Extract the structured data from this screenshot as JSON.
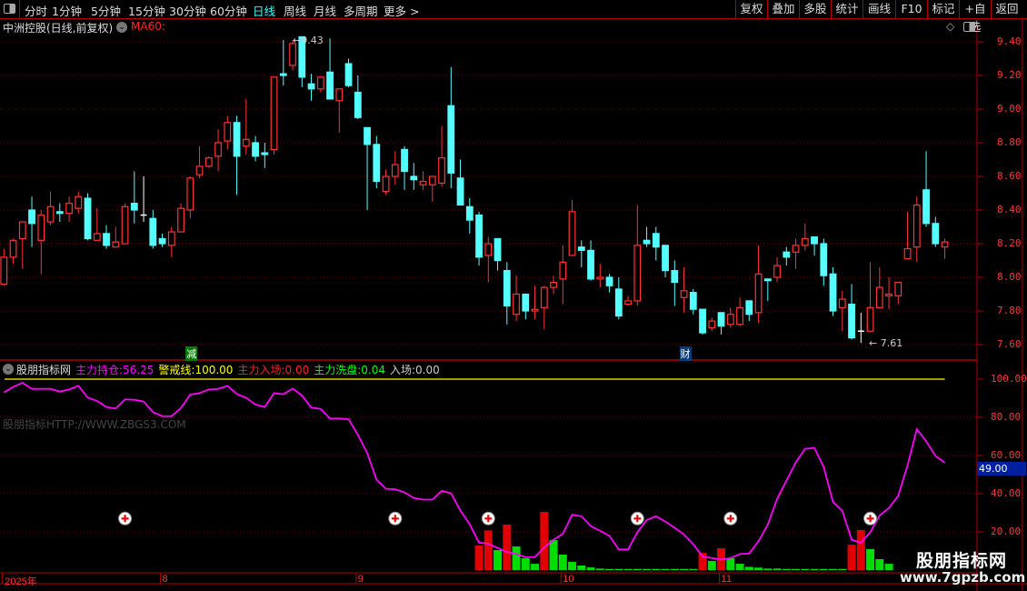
{
  "nav": {
    "periods": [
      "分时",
      "1分钟",
      "5分钟",
      "15分钟",
      "30分钟",
      "60分钟",
      "日线",
      "周线",
      "月线",
      "多周期",
      "更多 >"
    ],
    "active": "日线",
    "buttons": [
      "复权",
      "叠加",
      "多股",
      "统计",
      "画线",
      "F10",
      "标记",
      "+自选",
      "返回"
    ]
  },
  "main": {
    "title": "中洲控股(日线,前复权)",
    "ma_label": "MA60:",
    "high_marker": "9.43",
    "low_marker": "7.61",
    "event_tags": [
      {
        "text": "减",
        "candle": 21,
        "color": "#0a7a0a"
      },
      {
        "text": "财",
        "candle": 74,
        "color": "#0a3a7a"
      }
    ],
    "price_axis": [
      "9.40",
      "9.20",
      "9.00",
      "8.80",
      "8.60",
      "8.40",
      "8.20",
      "8.00",
      "7.80",
      "7.60"
    ]
  },
  "indicator": {
    "name": "股朋指标网",
    "items": [
      {
        "label": "主力持仓:",
        "value": "56.25",
        "color": "#ff00ff"
      },
      {
        "label": "警戒线:",
        "value": "100.00",
        "color": "#ffff00"
      },
      {
        "label": "主力入场:",
        "value": "0.00",
        "color": "#ff2020"
      },
      {
        "label": "主力洗盘:",
        "value": "0.04",
        "color": "#00ff00"
      },
      {
        "label": "入场:",
        "value": "0.00",
        "color": "#cccccc"
      }
    ],
    "watermark_url": "股朋指标HTTP://WWW.ZBGS3.COM",
    "axis": [
      "100.00",
      "80.00",
      "60.00",
      "40.00",
      "20.00"
    ],
    "current_box": "49.00"
  },
  "dates": [
    {
      "text": "2025年",
      "candle": 1
    },
    {
      "text": "8",
      "candle": 18
    },
    {
      "text": "9",
      "candle": 39
    },
    {
      "text": "10",
      "candle": 61
    },
    {
      "text": "11",
      "candle": 78
    }
  ],
  "brand": {
    "name": "股朋指标网",
    "url": "www.7gpzb.com"
  },
  "colors": {
    "up": "#ff3333",
    "down": "#55ffff",
    "doji": "#ffffff",
    "line": "#ff00ff",
    "warn": "#ffff00",
    "grid": "#800000",
    "border": "#b00000"
  },
  "chart_data": [
    {
      "type": "candlestick",
      "ylim": [
        7.55,
        9.45
      ],
      "grid": true,
      "candles_ochl": [
        [
          7.96,
          8.12,
          8.17,
          7.95
        ],
        [
          8.12,
          8.22,
          8.23,
          8.08
        ],
        [
          8.23,
          8.33,
          8.33,
          8.05
        ],
        [
          8.4,
          8.32,
          8.48,
          8.18
        ],
        [
          8.22,
          8.37,
          8.4,
          8.02
        ],
        [
          8.33,
          8.42,
          8.51,
          8.31
        ],
        [
          8.39,
          8.38,
          8.44,
          8.33
        ],
        [
          8.38,
          8.44,
          8.48,
          8.33
        ],
        [
          8.41,
          8.48,
          8.51,
          8.38
        ],
        [
          8.47,
          8.23,
          8.5,
          8.22
        ],
        [
          8.22,
          8.26,
          8.41,
          8.22
        ],
        [
          8.26,
          8.19,
          8.31,
          8.17
        ],
        [
          8.18,
          8.21,
          8.3,
          8.18
        ],
        [
          8.2,
          8.42,
          8.44,
          8.2
        ],
        [
          8.44,
          8.4,
          8.63,
          8.32
        ],
        [
          8.37,
          8.37,
          8.6,
          8.33
        ],
        [
          8.35,
          8.19,
          8.4,
          8.17
        ],
        [
          8.23,
          8.2,
          8.26,
          8.18
        ],
        [
          8.19,
          8.27,
          8.3,
          8.12
        ],
        [
          8.27,
          8.41,
          8.44,
          8.27
        ],
        [
          8.4,
          8.59,
          8.6,
          8.35
        ],
        [
          8.61,
          8.66,
          8.78,
          8.59
        ],
        [
          8.66,
          8.71,
          8.72,
          8.65
        ],
        [
          8.72,
          8.8,
          8.88,
          8.63
        ],
        [
          8.81,
          8.92,
          8.96,
          8.76
        ],
        [
          8.92,
          8.72,
          8.96,
          8.49
        ],
        [
          8.78,
          8.82,
          9.06,
          8.73
        ],
        [
          8.8,
          8.72,
          8.84,
          8.69
        ],
        [
          8.74,
          8.73,
          8.8,
          8.65
        ],
        [
          8.76,
          9.19,
          9.19,
          8.73
        ],
        [
          9.21,
          9.2,
          9.41,
          9.14
        ],
        [
          9.26,
          9.39,
          9.41,
          9.23
        ],
        [
          9.43,
          9.19,
          9.43,
          9.13
        ],
        [
          9.15,
          9.12,
          9.21,
          9.05
        ],
        [
          9.12,
          9.19,
          9.19,
          9.1
        ],
        [
          9.22,
          9.06,
          9.42,
          9.06
        ],
        [
          9.05,
          9.12,
          9.12,
          8.86
        ],
        [
          9.27,
          9.14,
          9.3,
          9.13
        ],
        [
          9.1,
          8.95,
          9.2,
          8.94
        ],
        [
          8.89,
          8.79,
          8.89,
          8.4
        ],
        [
          8.79,
          8.57,
          8.84,
          8.53
        ],
        [
          8.51,
          8.6,
          8.64,
          8.49
        ],
        [
          8.6,
          8.67,
          8.75,
          8.55
        ],
        [
          8.76,
          8.63,
          8.78,
          8.52
        ],
        [
          8.6,
          8.58,
          8.68,
          8.52
        ],
        [
          8.55,
          8.57,
          8.63,
          8.52
        ],
        [
          8.55,
          8.6,
          8.6,
          8.45
        ],
        [
          8.56,
          8.71,
          8.9,
          8.54
        ],
        [
          9.02,
          8.62,
          9.25,
          8.53
        ],
        [
          8.59,
          8.43,
          8.7,
          8.43
        ],
        [
          8.42,
          8.34,
          8.47,
          8.26
        ],
        [
          8.37,
          8.12,
          8.39,
          8.07
        ],
        [
          8.13,
          8.2,
          8.24,
          7.97
        ],
        [
          8.23,
          8.1,
          8.23,
          8.04
        ],
        [
          8.04,
          7.83,
          8.09,
          7.72
        ],
        [
          7.78,
          7.9,
          8.01,
          7.74
        ],
        [
          7.9,
          7.8,
          7.9,
          7.75
        ],
        [
          7.8,
          7.81,
          7.95,
          7.75
        ],
        [
          7.82,
          7.94,
          7.95,
          7.69
        ],
        [
          7.94,
          7.97,
          8.01,
          7.9
        ],
        [
          7.99,
          8.09,
          8.19,
          7.84
        ],
        [
          8.13,
          8.39,
          8.46,
          8.13
        ],
        [
          8.18,
          8.16,
          8.22,
          8.06
        ],
        [
          8.16,
          7.99,
          8.22,
          7.98
        ],
        [
          7.99,
          8.0,
          8.08,
          7.94
        ],
        [
          8.0,
          7.95,
          8.02,
          7.91
        ],
        [
          7.93,
          7.77,
          8.0,
          7.75
        ],
        [
          7.84,
          7.86,
          7.89,
          7.83
        ],
        [
          7.86,
          8.19,
          8.43,
          7.83
        ],
        [
          8.22,
          8.2,
          8.3,
          8.18
        ],
        [
          8.26,
          8.18,
          8.3,
          8.1
        ],
        [
          8.19,
          8.04,
          8.19,
          8.0
        ],
        [
          8.04,
          7.97,
          8.1,
          7.83
        ],
        [
          7.88,
          7.92,
          8.06,
          7.79
        ],
        [
          7.91,
          7.81,
          7.93,
          7.78
        ],
        [
          7.81,
          7.67,
          7.81,
          7.66
        ],
        [
          7.7,
          7.74,
          7.76,
          7.68
        ],
        [
          7.79,
          7.71,
          7.79,
          7.66
        ],
        [
          7.72,
          7.78,
          7.82,
          7.7
        ],
        [
          7.72,
          7.82,
          7.88,
          7.71
        ],
        [
          7.86,
          7.78,
          7.86,
          7.74
        ],
        [
          7.79,
          8.02,
          8.19,
          7.73
        ],
        [
          7.99,
          7.98,
          7.99,
          7.86
        ],
        [
          8.0,
          8.07,
          8.12,
          7.97
        ],
        [
          8.15,
          8.12,
          8.18,
          8.07
        ],
        [
          8.15,
          8.19,
          8.23,
          8.05
        ],
        [
          8.19,
          8.23,
          8.32,
          8.16
        ],
        [
          8.24,
          8.2,
          8.24,
          8.13
        ],
        [
          8.2,
          8.01,
          8.23,
          7.95
        ],
        [
          8.02,
          7.8,
          8.06,
          7.77
        ],
        [
          7.82,
          7.87,
          7.92,
          7.68
        ],
        [
          7.84,
          7.64,
          7.96,
          7.63
        ],
        [
          7.68,
          7.68,
          7.79,
          7.61
        ],
        [
          7.68,
          7.82,
          8.09,
          7.68
        ],
        [
          7.82,
          7.94,
          8.06,
          7.82
        ],
        [
          7.89,
          7.9,
          8.0,
          7.81
        ],
        [
          7.89,
          7.97,
          7.97,
          7.84
        ],
        [
          8.11,
          8.17,
          8.39,
          8.11
        ],
        [
          8.18,
          8.43,
          8.48,
          8.09
        ],
        [
          8.52,
          8.32,
          8.75,
          8.3
        ],
        [
          8.32,
          8.2,
          8.36,
          8.18
        ],
        [
          8.18,
          8.21,
          8.23,
          8.11
        ]
      ]
    },
    {
      "type": "line+bar",
      "ylim": [
        0,
        105
      ],
      "grid": true,
      "warning_level": 100,
      "series": [
        {
          "name": "主力持仓",
          "type": "line",
          "values": [
            93.0,
            95.9,
            98.1,
            94.9,
            94.9,
            94.9,
            93.5,
            94.6,
            96.5,
            90.3,
            88.6,
            85.4,
            84.6,
            89.4,
            89.2,
            88.3,
            82.7,
            80.6,
            80.6,
            84.8,
            91.9,
            92.7,
            94.6,
            94.9,
            96.5,
            92.2,
            90.3,
            86.7,
            85.4,
            92.7,
            92.1,
            95.1,
            91.4,
            85.1,
            84.4,
            79.4,
            79.4,
            79.0,
            70.8,
            61.3,
            47.3,
            42.6,
            42.3,
            40.7,
            37.8,
            36.9,
            36.9,
            41.5,
            40.2,
            31.2,
            24.0,
            14.4,
            13.8,
            11.6,
            9.5,
            8.4,
            6.8,
            6.8,
            11.9,
            15.9,
            19.0,
            29.0,
            28.2,
            23.0,
            20.6,
            17.9,
            10.8,
            10.8,
            19.8,
            26.2,
            28.2,
            25.4,
            22.2,
            18.6,
            13.5,
            7.1,
            6.3,
            5.5,
            6.3,
            8.4,
            8.7,
            15.1,
            23.8,
            37.3,
            46.8,
            56.3,
            63.5,
            64.0,
            54.0,
            35.7,
            31.0,
            15.9,
            14.3,
            19.8,
            28.6,
            32.5,
            38.9,
            54.8,
            73.8,
            67.5,
            59.8,
            56.25
          ]
        },
        {
          "name": "主力入场",
          "type": "bar",
          "points": [
            {
              "i": 52,
              "v": 12.9
            },
            {
              "i": 53,
              "v": 20.8
            },
            {
              "i": 55,
              "v": 23.8
            },
            {
              "i": 59,
              "v": 30.5
            },
            {
              "i": 76,
              "v": 9.0
            },
            {
              "i": 78,
              "v": 11.4
            },
            {
              "i": 92,
              "v": 13.3
            },
            {
              "i": 93,
              "v": 21.0
            }
          ]
        },
        {
          "name": "主力洗盘",
          "type": "bar",
          "points": [
            {
              "i": 54,
              "v": 10.5
            },
            {
              "i": 56,
              "v": 12.4
            },
            {
              "i": 57,
              "v": 6.2
            },
            {
              "i": 58,
              "v": 3.3
            },
            {
              "i": 60,
              "v": 15.7
            },
            {
              "i": 61,
              "v": 8.1
            },
            {
              "i": 62,
              "v": 4.3
            },
            {
              "i": 63,
              "v": 2.4
            },
            {
              "i": 64,
              "v": 1.4
            },
            {
              "i": 65,
              "v": 0.8
            },
            {
              "i": 66,
              "v": 0.6
            },
            {
              "i": 67,
              "v": 0.6
            },
            {
              "i": 68,
              "v": 0.6
            },
            {
              "i": 69,
              "v": 0.6
            },
            {
              "i": 70,
              "v": 0.6
            },
            {
              "i": 71,
              "v": 0.6
            },
            {
              "i": 72,
              "v": 0.6
            },
            {
              "i": 73,
              "v": 0.6
            },
            {
              "i": 74,
              "v": 0.6
            },
            {
              "i": 75,
              "v": 0.6
            },
            {
              "i": 77,
              "v": 4.8
            },
            {
              "i": 79,
              "v": 6.2
            },
            {
              "i": 80,
              "v": 3.3
            },
            {
              "i": 81,
              "v": 1.7
            },
            {
              "i": 82,
              "v": 1.3
            },
            {
              "i": 83,
              "v": 0.8
            },
            {
              "i": 84,
              "v": 0.8
            },
            {
              "i": 85,
              "v": 0.6
            },
            {
              "i": 86,
              "v": 0.6
            },
            {
              "i": 87,
              "v": 0.6
            },
            {
              "i": 88,
              "v": 0.6
            },
            {
              "i": 89,
              "v": 0.6
            },
            {
              "i": 90,
              "v": 0.6
            },
            {
              "i": 91,
              "v": 0.6
            },
            {
              "i": 94,
              "v": 11.0
            },
            {
              "i": 95,
              "v": 5.7
            },
            {
              "i": 96,
              "v": 3.3
            }
          ]
        }
      ],
      "entry_markers": {
        "candles": [
          14,
          43,
          53,
          69,
          79,
          94
        ],
        "level": 27
      }
    }
  ]
}
